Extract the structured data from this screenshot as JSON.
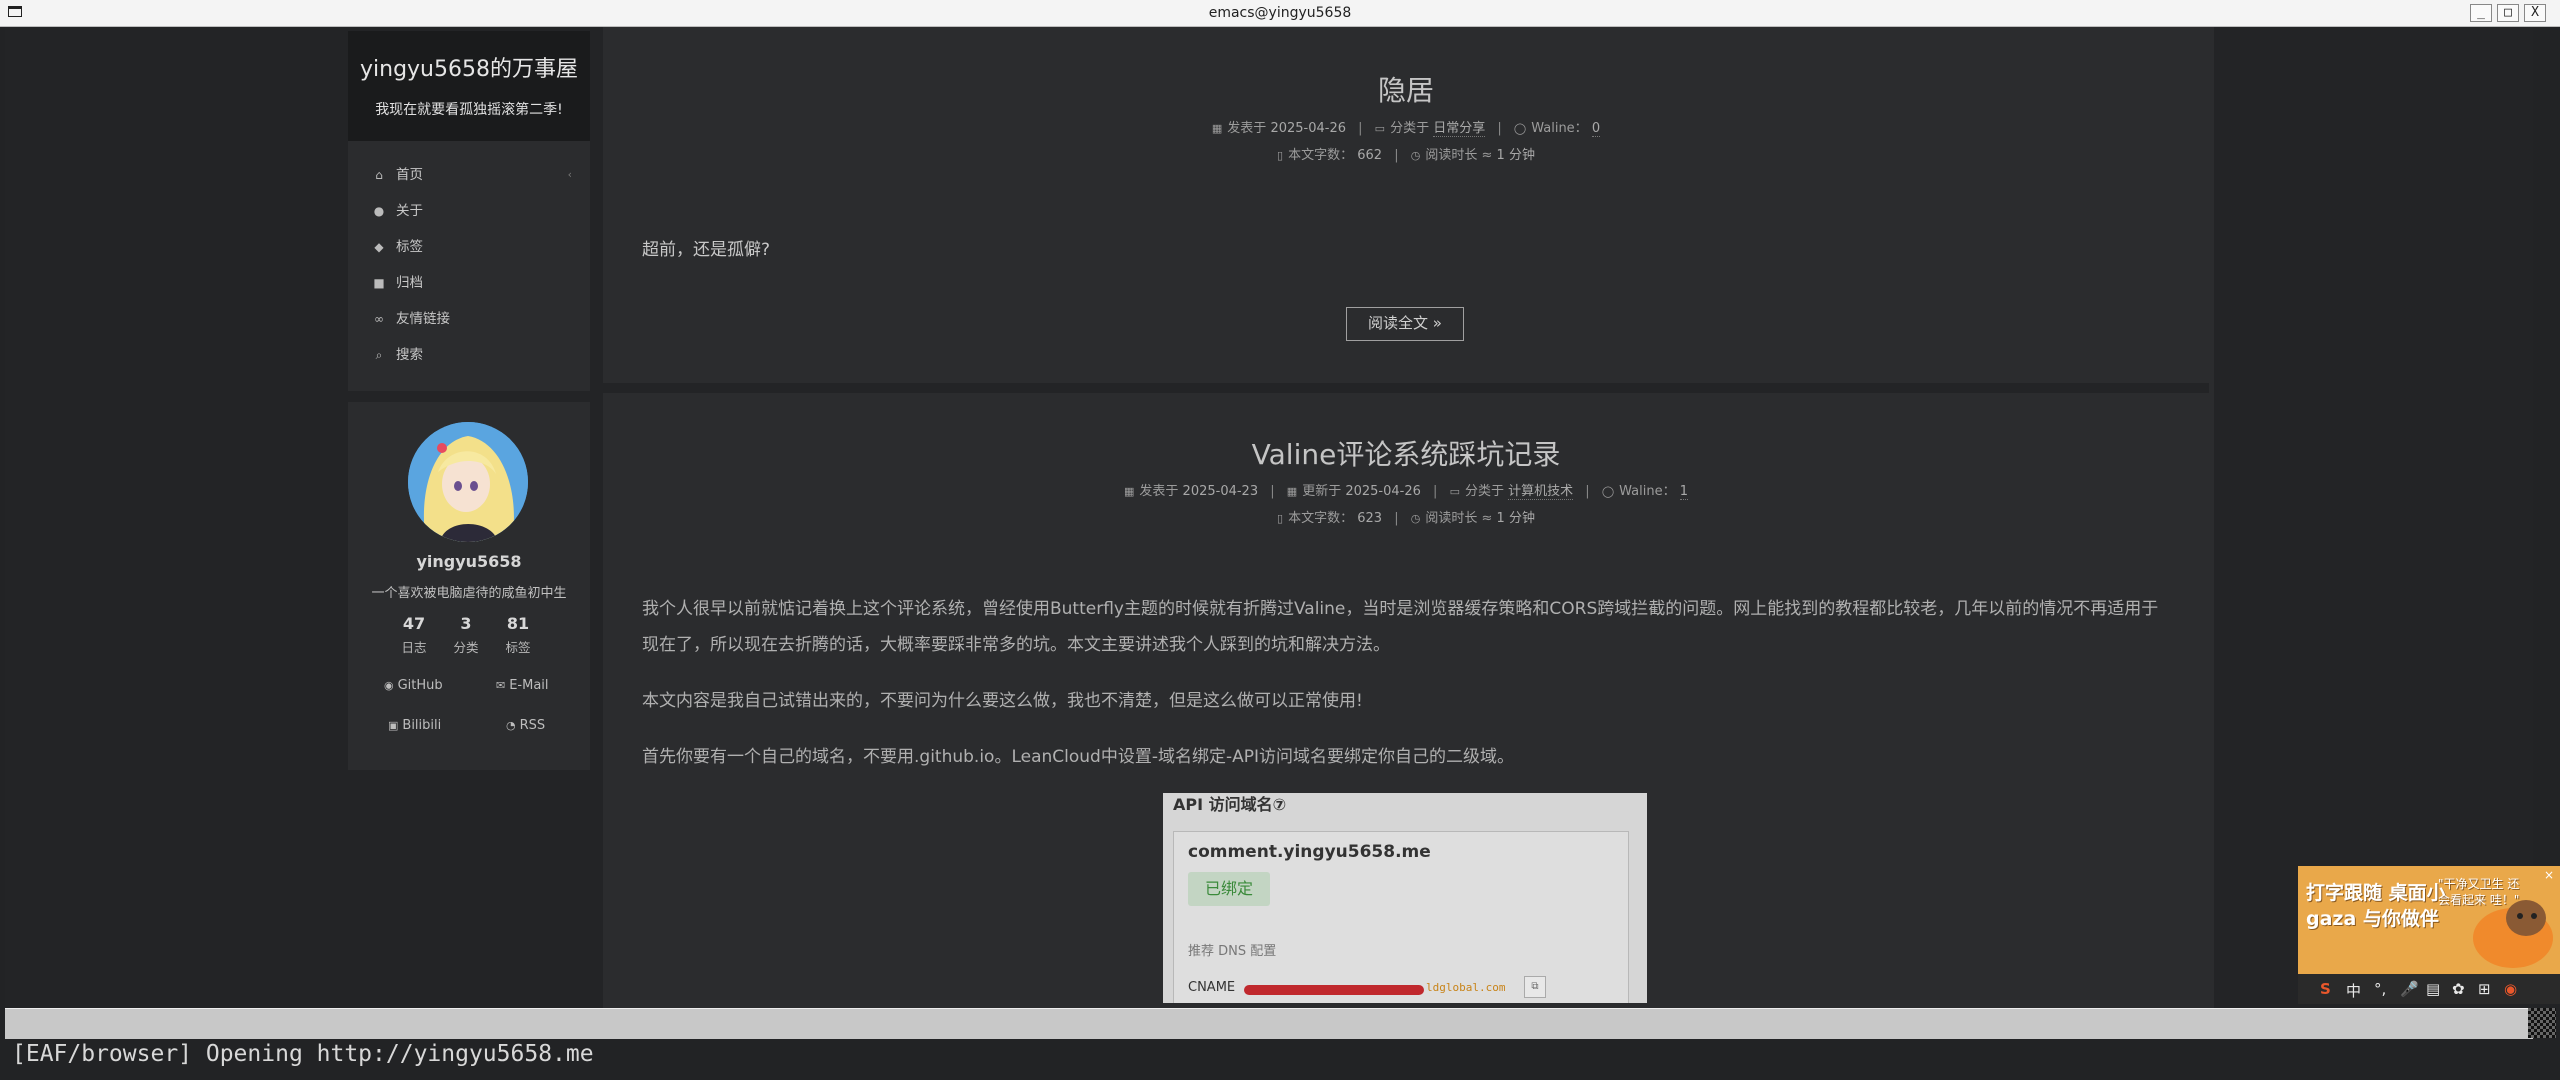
{
  "window": {
    "title": "emacs@yingyu5658",
    "buttons": [
      "_",
      "□",
      "X"
    ]
  },
  "sidebar": {
    "site_title": "yingyu5658的万事屋",
    "site_subtitle": "我现在就要看孤独摇滚第二季!",
    "menu": [
      {
        "label": "首页",
        "icon": "home-icon",
        "glyph": "⌂"
      },
      {
        "label": "关于",
        "icon": "user-icon",
        "glyph": "●"
      },
      {
        "label": "标签",
        "icon": "tags-icon",
        "glyph": "◆"
      },
      {
        "label": "归档",
        "icon": "archive-icon",
        "glyph": "■"
      },
      {
        "label": "友情链接",
        "icon": "link-icon",
        "glyph": "∞"
      },
      {
        "label": "搜索",
        "icon": "search-icon",
        "glyph": "⌕"
      }
    ],
    "menu_active_chevron": "‹",
    "profile": {
      "name": "yingyu5658",
      "description": "一个喜欢被电脑虐待的咸鱼初中生",
      "stats": [
        {
          "num": "47",
          "label": "日志"
        },
        {
          "num": "3",
          "label": "分类"
        },
        {
          "num": "81",
          "label": "标签"
        }
      ],
      "links": [
        {
          "label": "GitHub",
          "icon": "github-icon",
          "glyph": "◉"
        },
        {
          "label": "E-Mail",
          "icon": "mail-icon",
          "glyph": "✉"
        },
        {
          "label": "Bilibili",
          "icon": "bilibili-icon",
          "glyph": "▣"
        },
        {
          "label": "RSS",
          "icon": "rss-icon",
          "glyph": "◔"
        }
      ]
    }
  },
  "posts": [
    {
      "title": "隐居",
      "meta1": {
        "posted_label": "发表于",
        "posted": "2025-04-26",
        "category_label": "分类于",
        "category": "日常分享",
        "comments_label": "Waline：",
        "comments": "0"
      },
      "meta2": {
        "words_label": "本文字数：",
        "words": "662",
        "time_label": "阅读时长 ≈",
        "time": "1 分钟"
      },
      "excerpt": "超前，还是孤僻?",
      "read_more": "阅读全文 »"
    },
    {
      "title": "Valine评论系统踩坑记录",
      "meta1": {
        "posted_label": "发表于",
        "posted": "2025-04-23",
        "updated_label": "更新于",
        "updated": "2025-04-26",
        "category_label": "分类于",
        "category": "计算机技术",
        "comments_label": "Waline：",
        "comments": "1"
      },
      "meta2": {
        "words_label": "本文字数：",
        "words": "623",
        "time_label": "阅读时长 ≈",
        "time": "1 分钟"
      },
      "paragraphs": [
        "我个人很早以前就惦记着换上这个评论系统，曾经使用Butterfly主题的时候就有折腾过Valine，当时是浏览器缓存策略和CORS跨域拦截的问题。网上能找到的教程都比较老，几年以前的情况不再适用于现在了，所以现在去折腾的话，大概率要踩非常多的坑。本文主要讲述我个人踩到的坑和解决方法。",
        "本文内容是我自己试错出来的，不要问为什么要这么做，我也不清楚，但是这么做可以正常使用!",
        "首先你要有一个自己的域名，不要用.github.io。LeanCloud中设置-域名绑定-API访问域名要绑定你自己的二级域。"
      ],
      "screenshot": {
        "heading": "API 访问域名⑦",
        "domain": "comment.yingyu5658.me",
        "status": "已绑定",
        "dns_label": "推荐 DNS 配置",
        "cname_label": "CNAME",
        "cname_tail": "ldglobal.com"
      }
    }
  ],
  "ad": {
    "text": "打字跟随  桌面小gaza 与你做伴",
    "quote": "\"干净又卫生 还会看起来 哇！\"",
    "close": "×"
  },
  "tray": {
    "icons": [
      "S",
      "中",
      "°,",
      "🎤",
      "▤",
      "✿",
      "⊞",
      "◉"
    ]
  },
  "echo_area": "[EAF/browser] Opening http://yingyu5658.me"
}
